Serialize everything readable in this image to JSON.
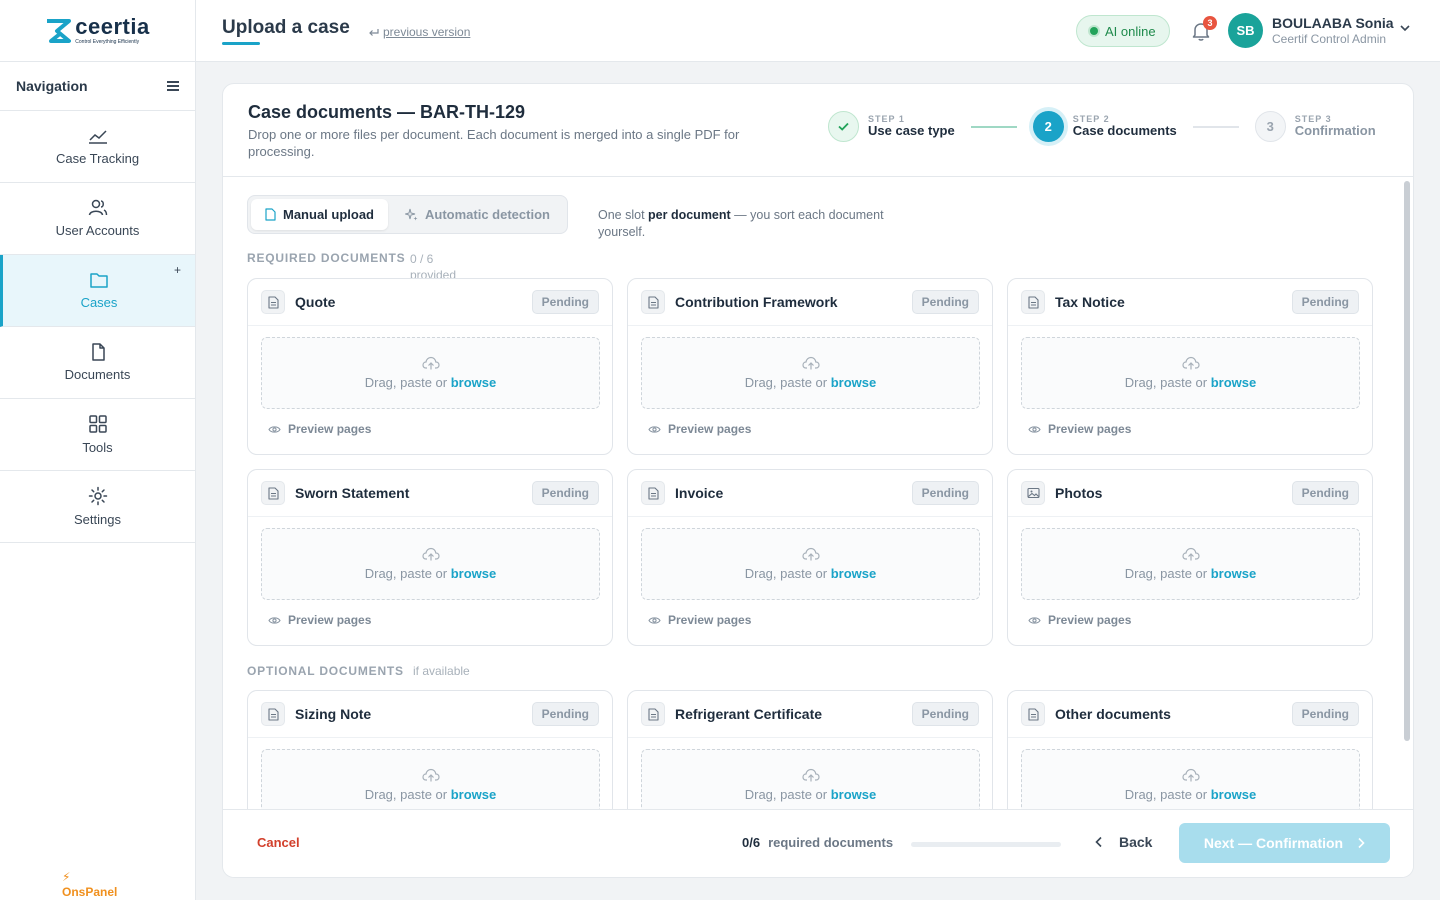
{
  "app": {
    "logo_name": "ceertia",
    "logo_tagline": "Control Everything Efficiently",
    "brand_color": "#1aa3c8"
  },
  "sidebar": {
    "title": "Navigation",
    "items": [
      {
        "label": "Case Tracking",
        "icon": "chart-line-icon",
        "active": false
      },
      {
        "label": "User Accounts",
        "icon": "users-icon",
        "active": false
      },
      {
        "label": "Cases",
        "icon": "folder-icon",
        "active": true,
        "extra": "+"
      },
      {
        "label": "Documents",
        "icon": "document-icon",
        "active": false
      },
      {
        "label": "Tools",
        "icon": "grid-icon",
        "active": false
      },
      {
        "label": "Settings",
        "icon": "gear-icon",
        "active": false
      }
    ],
    "footer_brand": "OnsPanel"
  },
  "topbar": {
    "title": "Upload a case",
    "previous_version": "previous version",
    "ai_status": "AI online",
    "notification_count": "3",
    "user_initials": "SB",
    "user_name": "BOULAABA Sonia",
    "user_role": "Ceertif Control Admin"
  },
  "card": {
    "title": "Case documents — BAR-TH-129",
    "subtitle": "Drop one or more files per document. Each document is merged into a single PDF for processing.",
    "steps": [
      {
        "key": "STEP 1",
        "label": "Use case type",
        "state": "done"
      },
      {
        "key": "STEP 2",
        "label": "Case documents",
        "state": "current",
        "number": "2"
      },
      {
        "key": "STEP 3",
        "label": "Confirmation",
        "state": "todo",
        "number": "3"
      }
    ],
    "modes": {
      "manual": "Manual upload",
      "auto": "Automatic detection",
      "note_prefix": "One slot ",
      "note_bold": "per document",
      "note_suffix": " — you sort each document yourself."
    },
    "required": {
      "label": "REQUIRED DOCUMENTS",
      "hint": "0 / 6 provided",
      "slots": [
        {
          "title": "Quote",
          "icon": "document-icon",
          "status": "Pending"
        },
        {
          "title": "Contribution Framework",
          "icon": "document-icon",
          "status": "Pending"
        },
        {
          "title": "Tax Notice",
          "icon": "document-icon",
          "status": "Pending"
        },
        {
          "title": "Sworn Statement",
          "icon": "document-icon",
          "status": "Pending"
        },
        {
          "title": "Invoice",
          "icon": "document-icon",
          "status": "Pending"
        },
        {
          "title": "Photos",
          "icon": "image-icon",
          "status": "Pending"
        }
      ]
    },
    "optional": {
      "label": "OPTIONAL DOCUMENTS",
      "hint": "if available",
      "slots": [
        {
          "title": "Sizing Note",
          "icon": "document-icon",
          "status": "Pending"
        },
        {
          "title": "Refrigerant Certificate",
          "icon": "document-icon",
          "status": "Pending"
        },
        {
          "title": "Other documents",
          "icon": "document-icon",
          "status": "Pending"
        }
      ]
    },
    "dropzone_text": "Drag, paste or ",
    "dropzone_link": "browse",
    "preview_label": "Preview pages"
  },
  "footer": {
    "cancel": "Cancel",
    "count": "0/6",
    "count_label": "required documents",
    "progress": 0,
    "back": "Back",
    "next": "Next — Confirmation"
  }
}
